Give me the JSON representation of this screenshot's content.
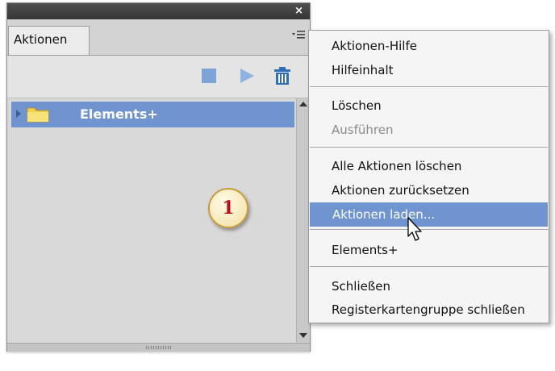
{
  "panel": {
    "tab_label": "Aktionen",
    "close_glyph": "×",
    "list_items": [
      {
        "label": "Elements+",
        "icon": "folder-icon",
        "selected": true
      }
    ]
  },
  "toolbar": {
    "icons": [
      "stop-icon",
      "play-icon",
      "trash-icon"
    ]
  },
  "callout": {
    "number": "1"
  },
  "context_menu": {
    "items": [
      {
        "label": "Aktionen-Hilfe"
      },
      {
        "label": "Hilfeinhalt"
      },
      {
        "label": "Löschen"
      },
      {
        "label": "Ausführen",
        "disabled": true
      },
      {
        "label": "Alle Aktionen löschen"
      },
      {
        "label": "Aktionen zurücksetzen"
      },
      {
        "label": "Aktionen laden...",
        "highlighted": true
      },
      {
        "label": "Elements+"
      },
      {
        "label": "Schließen"
      },
      {
        "label": "Registerkartengruppe schließen"
      }
    ]
  },
  "colors": {
    "selection": "#6f94cf",
    "toolbar_icon_blue": "#7ea3d6",
    "folder_yellow": "#f2d24a",
    "badge_number": "#b5121b"
  }
}
